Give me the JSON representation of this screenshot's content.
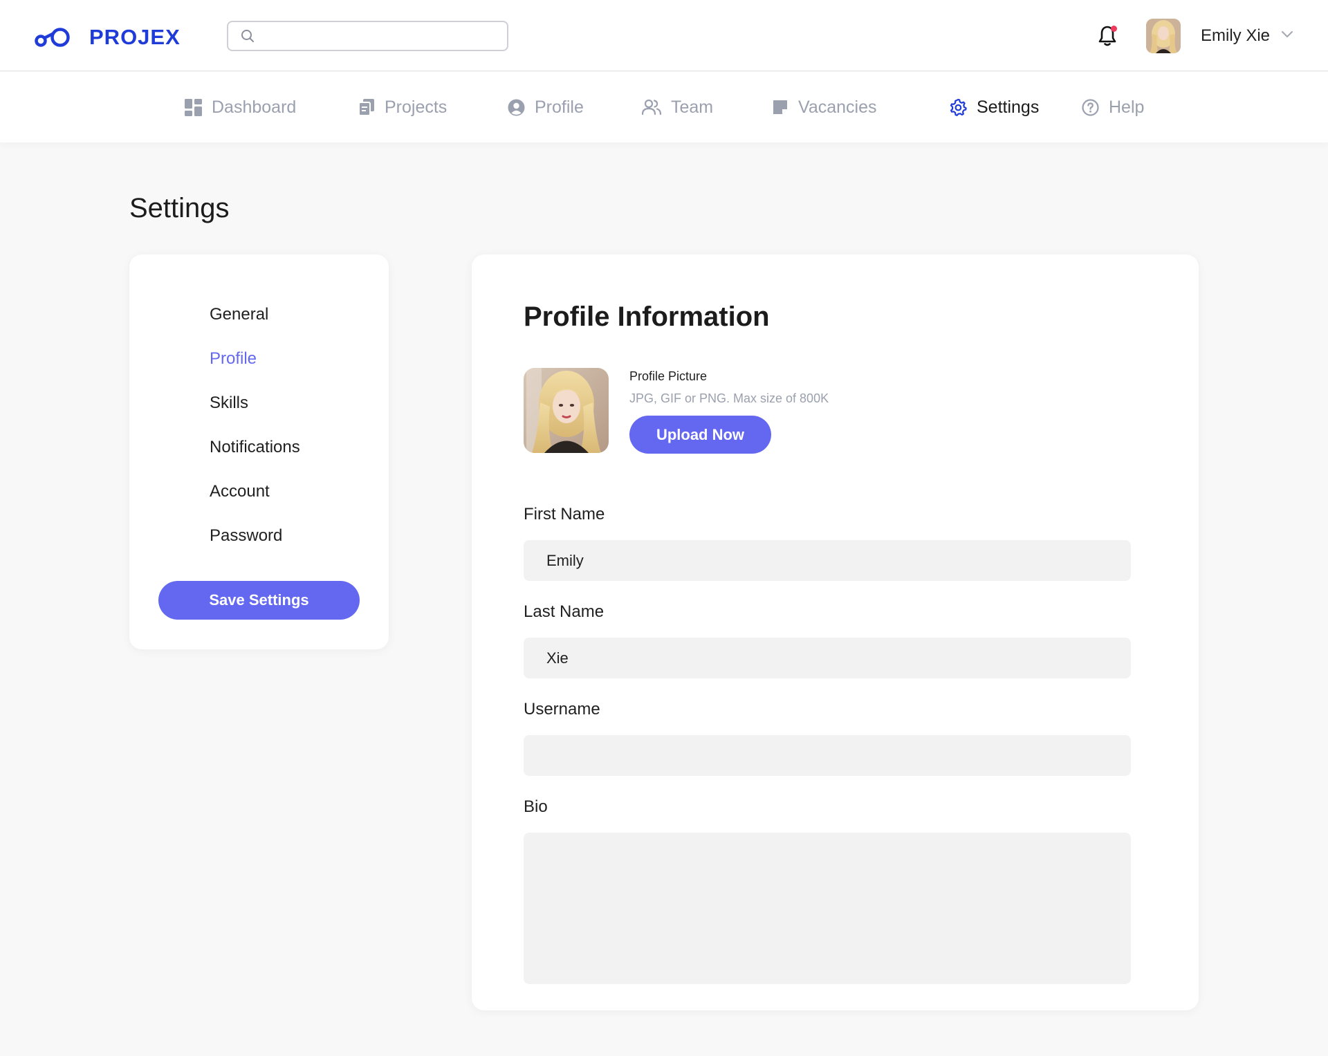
{
  "app": {
    "brand": "PROJEX"
  },
  "header": {
    "search": {
      "value": "",
      "placeholder": ""
    },
    "user_name": "Emily Xie"
  },
  "nav": {
    "items": [
      {
        "label": "Dashboard",
        "icon": "dashboard-icon"
      },
      {
        "label": "Projects",
        "icon": "projects-icon"
      },
      {
        "label": "Profile",
        "icon": "profile-icon"
      },
      {
        "label": "Team",
        "icon": "team-icon"
      },
      {
        "label": "Vacancies",
        "icon": "vacancies-icon"
      },
      {
        "label": "Settings",
        "icon": "settings-icon",
        "active": true
      },
      {
        "label": "Help",
        "icon": "help-icon"
      }
    ]
  },
  "page": {
    "title": "Settings"
  },
  "settings_menu": {
    "items": [
      {
        "label": "General"
      },
      {
        "label": "Profile",
        "active": true
      },
      {
        "label": "Skills"
      },
      {
        "label": "Notifications"
      },
      {
        "label": "Account"
      },
      {
        "label": "Password"
      }
    ],
    "save_label": "Save Settings"
  },
  "profile_info": {
    "title": "Profile Information",
    "picture": {
      "label": "Profile Picture",
      "hint": "JPG, GIF or PNG. Max size of 800K",
      "upload_label": "Upload Now"
    },
    "fields": {
      "first_name": {
        "label": "First Name",
        "value": "Emily"
      },
      "last_name": {
        "label": "Last Name",
        "value": "Xie"
      },
      "username": {
        "label": "Username",
        "value": ""
      },
      "bio": {
        "label": "Bio",
        "value": ""
      }
    }
  },
  "colors": {
    "brand": "#1f3bd8",
    "accent": "#6468f0",
    "nav_inactive": "#9aa0ad",
    "notification_dot": "#ef3a5d",
    "input_bg": "#f2f2f2"
  }
}
